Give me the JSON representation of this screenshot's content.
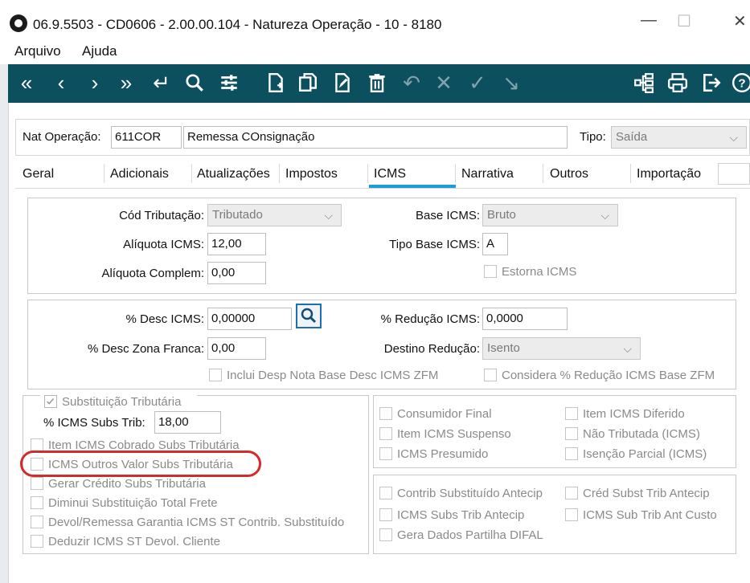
{
  "window": {
    "title": "06.9.5503 - CD0606 - 2.00.00.104 - Natureza Operação - 10 - 8180",
    "controls": {
      "minimize": "—",
      "maximize": "☐",
      "close": "✕"
    }
  },
  "menu": {
    "items": [
      "Arquivo",
      "Ajuda"
    ]
  },
  "toolbar": {
    "buttons": [
      "first-icon",
      "previous-icon",
      "next-icon",
      "last-icon",
      "goto-icon",
      "search-icon",
      "filter-icon",
      "new-icon",
      "copy-icon",
      "edit-icon",
      "delete-icon",
      "undo-icon",
      "cancel-icon",
      "confirm-icon",
      "commit-icon",
      "hierarchy-icon",
      "print-icon",
      "exit-icon",
      "help-icon"
    ]
  },
  "header": {
    "nat_label": "Nat Operação:",
    "nat_code": "611COR",
    "nat_desc": "Remessa COnsignação",
    "tipo_label": "Tipo:",
    "tipo_value": "Saída"
  },
  "tabs": [
    "Geral",
    "Adicionais",
    "Atualizações",
    "Impostos",
    "ICMS",
    "Narrativa",
    "Outros",
    "Importação"
  ],
  "active_tab": "ICMS",
  "section1": {
    "cod_trib_label": "Cód Tributação:",
    "cod_trib_value": "Tributado",
    "aliquota_label": "Alíquota ICMS:",
    "aliquota_value": "12,00",
    "aliq_complem_label": "Alíquota Complem:",
    "aliq_complem_value": "0,00",
    "base_icms_label": "Base ICMS:",
    "base_icms_value": "Bruto",
    "tipo_base_label": "Tipo Base ICMS:",
    "tipo_base_value": "A",
    "estorna_label": "Estorna ICMS"
  },
  "section2": {
    "desc_icms_label": "% Desc ICMS:",
    "desc_icms_value": "0,00000",
    "desc_zona_label": "% Desc Zona Franca:",
    "desc_zona_value": "0,00",
    "reducao_label": "% Redução ICMS:",
    "reducao_value": "0,0000",
    "destino_label": "Destino Redução:",
    "destino_value": "Isento",
    "inclui_label": "Inclui Desp Nota Base Desc ICMS ZFM",
    "considera_label": "Considera % Redução ICMS Base ZFM"
  },
  "section3": {
    "subst_label": "Substituição Tributária",
    "subs_trib_label": "% ICMS Subs Trib:",
    "subs_trib_value": "18,00",
    "checks": [
      "Item ICMS Cobrado Subs Tributária",
      "ICMS Outros Valor Subs Tributária",
      "Gerar Crédito Subs Tributária",
      "Diminui Substituição Total Frete",
      "Devol/Remessa Garantia ICMS ST Contrib. Substituído",
      "Deduzir ICMS ST Devol. Cliente"
    ]
  },
  "section4": {
    "left": [
      "Consumidor Final",
      "Item ICMS Suspenso",
      "ICMS Presumido"
    ],
    "right": [
      "Item ICMS Diferido",
      "Não Tributada (ICMS)",
      "Isenção Parcial (ICMS)"
    ]
  },
  "section5": {
    "left": [
      "Contrib Substituído Antecip",
      "ICMS Subs Trib Antecip",
      "Gera Dados Partilha DIFAL"
    ],
    "right": [
      "Créd Subst Trib Antecip",
      "ICMS Sub Trib Ant Custo"
    ]
  },
  "colors": {
    "toolbar_bg": "#0c4f5f",
    "tab_underline": "#1aa0d8",
    "highlight": "#d22b2b"
  }
}
